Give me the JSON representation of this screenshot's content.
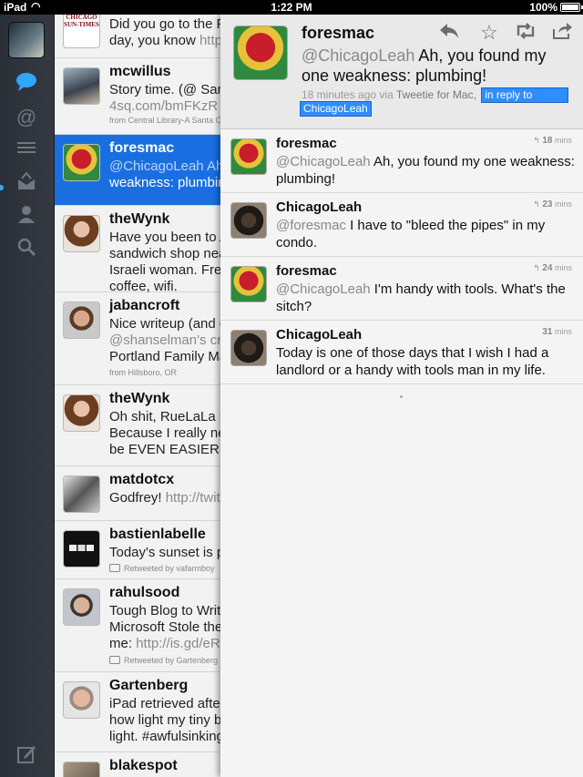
{
  "status_bar": {
    "carrier": "iPad",
    "time": "1:22 PM",
    "battery": "100%"
  },
  "timeline": [
    {
      "name": "",
      "text": "Did you go to the F",
      "text2": "day, you know ",
      "link": "http",
      "meta": ""
    },
    {
      "name": "mcwillus",
      "text": "Story time. (@ Sar",
      "text2": "",
      "link": "4sq.com/bmFKzR",
      "meta": "from Central Library-A Santa C"
    },
    {
      "name": "foresmac",
      "text": "@ChicagoLeah Ah",
      "text2": "weakness: plumbin",
      "link": "",
      "meta": ""
    },
    {
      "name": "theWynk",
      "text": "Have you been to A",
      "text2": "sandwich shop nea",
      "text3": "Israeli woman. Fre",
      "text4": "coffee, wifi.",
      "meta": ""
    },
    {
      "name": "jabancroft",
      "text": "Nice writeup (and c",
      "text2": "@shanselman's cr",
      "text3": "Portland Family Ma",
      "meta": "from Hillsboro, OR"
    },
    {
      "name": "theWynk",
      "text": "Oh shit, RueLaLa h",
      "text2": "Because I really ne",
      "text3": "be EVEN EASIER.",
      "meta": ""
    },
    {
      "name": "matdotcx",
      "text": "Godfrey!  ",
      "link": "http://twit",
      "meta": ""
    },
    {
      "name": "bastienlabelle",
      "text": "Today's sunset is p",
      "meta": "Retweeted by vafarmboy"
    },
    {
      "name": "rahulsood",
      "text": "Tough Blog to Writ",
      "text2": "Microsoft Stole the",
      "text3": "me: ",
      "link": "http://is.gd/eR",
      "meta": "Retweeted by Gartenberg"
    },
    {
      "name": "Gartenberg",
      "text": "iPad retrieved after",
      "text2": "how light my tiny b",
      "text3": "light. #awfulsinking",
      "meta": ""
    },
    {
      "name": "blakespot",
      "text": "",
      "meta": ""
    }
  ],
  "detail": {
    "name": "foresmac",
    "mention": "@ChicagoLeah",
    "text": " Ah, you found my one weakness: plumbing!",
    "time": "18 minutes ago",
    "via": "via",
    "client": "Tweetie for Mac,",
    "in_reply_to": "in reply to",
    "reply_name": "ChicagoLeah"
  },
  "actions": {
    "reply_icon": "reply-icon",
    "favorite_icon": "star-icon",
    "retweet_icon": "retweet-icon",
    "share_icon": "share-icon"
  },
  "conversation": [
    {
      "name": "foresmac",
      "mention": "@ChicagoLeah",
      "text": " Ah, you found my one weakness: plumbing!",
      "time": "18",
      "unit": "mins",
      "reply": true
    },
    {
      "name": "ChicagoLeah",
      "mention": "@foresmac",
      "text": " I have to \"bleed the pipes\" in my condo.",
      "time": "23",
      "unit": "mins",
      "reply": true
    },
    {
      "name": "foresmac",
      "mention": "@ChicagoLeah",
      "text": " I'm handy with tools. What's the sitch?",
      "time": "24",
      "unit": "mins",
      "reply": true
    },
    {
      "name": "ChicagoLeah",
      "mention": "",
      "text": "Today is one of those days that I wish I had a landlord or a handy with tools man in my life.",
      "time": "31",
      "unit": "mins",
      "reply": false
    }
  ]
}
